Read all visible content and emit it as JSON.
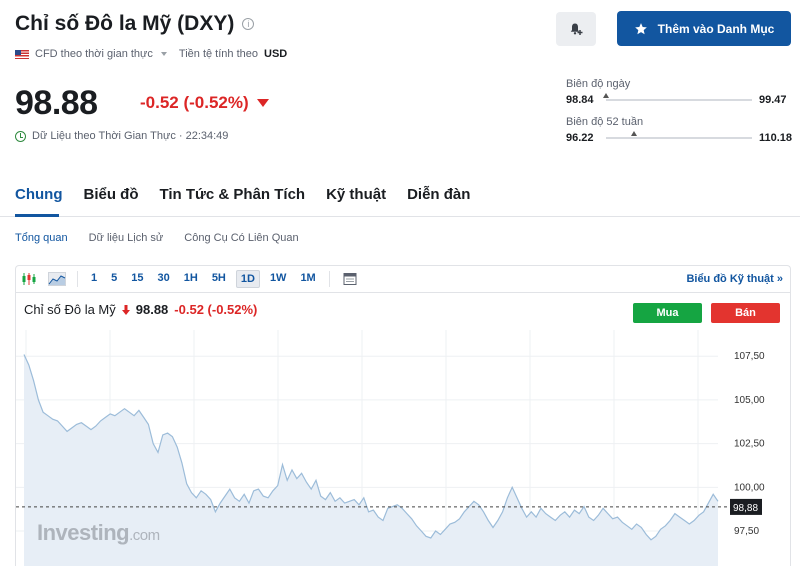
{
  "header": {
    "title": "Chỉ số Đô la Mỹ (DXY)",
    "info_glyph": "i",
    "cfd_label": "CFD theo thời gian thực",
    "currency_label": "Tiền tệ tính theo",
    "currency_value": "USD",
    "price": "98.88",
    "change": "-0.52 (-0.52%)",
    "realtime_label": "Dữ Liệu theo Thời Gian Thực · 22:34:49",
    "watchlist_button": "Thêm vào Danh Mục"
  },
  "ranges": {
    "day": {
      "label": "Biên độ ngày",
      "low": "98.84",
      "high": "99.47",
      "position": 0.0
    },
    "week52": {
      "label": "Biên độ 52 tuần",
      "low": "96.22",
      "high": "110.18",
      "position": 0.19
    }
  },
  "tabs": [
    {
      "label": "Chung",
      "active": true
    },
    {
      "label": "Biểu đồ",
      "active": false
    },
    {
      "label": "Tin Tức & Phân Tích",
      "active": false
    },
    {
      "label": "Kỹ thuật",
      "active": false
    },
    {
      "label": "Diễn đàn",
      "active": false
    }
  ],
  "subtabs": [
    {
      "label": "Tổng quan",
      "active": true
    },
    {
      "label": "Dữ liệu Lịch sử",
      "active": false
    },
    {
      "label": "Công Cụ Có Liên Quan",
      "active": false
    }
  ],
  "toolbar": {
    "timeframes": [
      "1",
      "5",
      "15",
      "30",
      "1H",
      "5H",
      "1D",
      "1W",
      "1M"
    ],
    "active_timeframe": "1D",
    "tech_chart_link": "Biểu đồ Kỹ thuật »",
    "icons": [
      "candlestick-icon",
      "area-chart-icon",
      "calendar-icon"
    ]
  },
  "chart_legend": {
    "name": "Chỉ số Đô la Mỹ",
    "price": "98.88",
    "change": "-0.52 (-0.52%)",
    "buy_label": "Mua",
    "sell_label": "Bán"
  },
  "watermark": {
    "brand": "Investing",
    "suffix": ".com"
  },
  "colors": {
    "accent": "#1256a0",
    "down": "#dc2626",
    "buy": "#15a542",
    "sell": "#e3342f",
    "area_fill": "#e7eef6",
    "line": "#9cbcd9"
  },
  "chart_data": {
    "type": "area",
    "title": "",
    "xlabel": "",
    "ylabel": "",
    "ylim": [
      95.5,
      109
    ],
    "yticks": [
      "107,50",
      "105,00",
      "102,50",
      "100,00",
      "97,50"
    ],
    "ytick_values": [
      107.5,
      105.0,
      102.5,
      100.0,
      97.5
    ],
    "current_value": 98.88,
    "current_label": "98,88",
    "grid": true,
    "values": [
      107.6,
      107.0,
      106.1,
      105.0,
      104.3,
      104.1,
      103.9,
      103.8,
      103.5,
      103.2,
      103.4,
      103.6,
      103.7,
      103.5,
      103.3,
      103.5,
      103.8,
      104.0,
      104.2,
      104.1,
      104.3,
      104.5,
      104.3,
      104.1,
      104.4,
      104.0,
      103.6,
      102.5,
      102.0,
      103.0,
      103.1,
      102.9,
      102.3,
      101.4,
      100.2,
      99.7,
      99.4,
      99.8,
      99.6,
      99.3,
      98.6,
      99.1,
      99.5,
      99.9,
      99.4,
      99.2,
      99.6,
      99.1,
      99.8,
      99.9,
      99.5,
      99.4,
      99.8,
      100.1,
      101.3,
      100.4,
      101.0,
      100.5,
      100.8,
      100.3,
      99.9,
      100.4,
      99.5,
      99.3,
      99.7,
      99.2,
      99.4,
      99.1,
      99.2,
      99.3,
      99.0,
      99.4,
      98.6,
      98.7,
      98.3,
      98.1,
      98.8,
      98.9,
      99.0,
      98.8,
      98.5,
      98.2,
      97.8,
      97.5,
      97.2,
      97.1,
      97.5,
      97.3,
      97.6,
      97.9,
      98.0,
      98.2,
      98.6,
      98.9,
      99.2,
      99.0,
      98.6,
      98.1,
      97.7,
      98.1,
      98.6,
      99.4,
      100.0,
      99.4,
      98.8,
      98.3,
      98.6,
      98.3,
      98.8,
      98.5,
      98.3,
      98.1,
      98.4,
      98.6,
      98.3,
      98.7,
      98.5,
      98.9,
      98.3,
      98.1,
      98.4,
      98.8,
      98.5,
      98.2,
      98.3,
      98.0,
      97.8,
      97.6,
      97.9,
      97.7,
      97.3,
      97.0,
      97.2,
      97.6,
      97.8,
      98.1,
      98.5,
      98.3,
      98.1,
      97.9,
      98.1,
      98.4,
      98.6,
      99.1,
      99.6,
      99.2
    ]
  }
}
